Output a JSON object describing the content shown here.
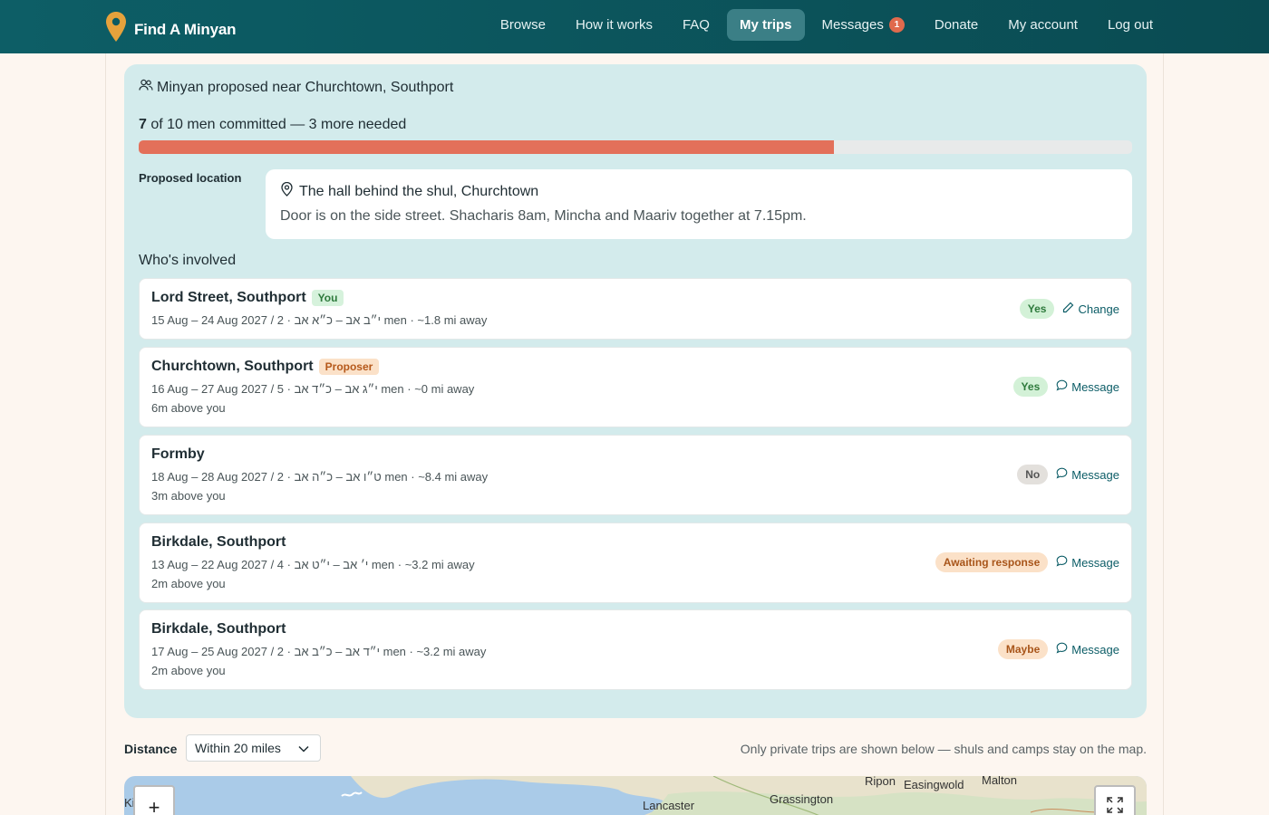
{
  "brand": {
    "name": "Find A Minyan",
    "icon": "map-pin-icon",
    "pin_color": "#e6a23c"
  },
  "nav": {
    "items": [
      {
        "label": "Browse"
      },
      {
        "label": "How it works"
      },
      {
        "label": "FAQ"
      },
      {
        "label": "My trips",
        "active": true
      },
      {
        "label": "Messages",
        "badge": "1"
      },
      {
        "label": "Donate"
      },
      {
        "label": "My account"
      },
      {
        "label": "Log out"
      }
    ]
  },
  "minyan": {
    "title": "Minyan proposed near Churchtown, Southport",
    "title_icon": "people-icon",
    "committed_count": "7",
    "committed_text": " of 10 men committed — 3 more needed",
    "progress_fraction": 0.7,
    "location_label": "Proposed location",
    "location_name": "The hall behind the shul, Churchtown",
    "location_icon": "location-pin-icon",
    "location_desc": "Door is on the side street. Shacharis 8am, Mincha and Maariv together at 7.15pm.",
    "involved_title": "Who's involved"
  },
  "trips": [
    {
      "name": "Lord Street, Southport",
      "tag": "You",
      "tag_type": "you",
      "meta": "15 Aug – 24 Aug 2027 / י״ב אב – כ״א אב · 2 men · ~1.8 mi away",
      "sub": "",
      "status": "Yes",
      "status_type": "yes",
      "action": "Change",
      "action_icon": "pencil-icon"
    },
    {
      "name": "Churchtown, Southport",
      "tag": "Proposer",
      "tag_type": "proposer",
      "meta": "16 Aug – 27 Aug 2027 / י״ג אב – כ״ד אב · 5 men · ~0 mi away",
      "sub": "6m above you",
      "status": "Yes",
      "status_type": "yes",
      "action": "Message",
      "action_icon": "chat-icon"
    },
    {
      "name": "Formby",
      "tag": "",
      "tag_type": "",
      "meta": "18 Aug – 28 Aug 2027 / ט״ו אב – כ״ה אב · 2 men · ~8.4 mi away",
      "sub": "3m above you",
      "status": "No",
      "status_type": "no",
      "action": "Message",
      "action_icon": "chat-icon"
    },
    {
      "name": "Birkdale, Southport",
      "tag": "",
      "tag_type": "",
      "meta": "13 Aug – 22 Aug 2027 / י׳ אב – י״ט אב · 4 men · ~3.2 mi away",
      "sub": "2m above you",
      "status": "Awaiting response",
      "status_type": "await",
      "action": "Message",
      "action_icon": "chat-icon"
    },
    {
      "name": "Birkdale, Southport",
      "tag": "",
      "tag_type": "",
      "meta": "17 Aug – 25 Aug 2027 / י״ד אב – כ״ב אב · 2 men · ~3.2 mi away",
      "sub": "2m above you",
      "status": "Maybe",
      "status_type": "maybe",
      "action": "Message",
      "action_icon": "chat-icon"
    }
  ],
  "distance": {
    "label": "Distance",
    "selected": "Within 20 miles",
    "note": "Only private trips are shown below — shuls and camps stay on the map."
  },
  "map": {
    "zoom_in_label": "+",
    "fullscreen_icon": "expand-icon",
    "places": [
      "Ki",
      "Lancaster",
      "Grassington",
      "Ripon",
      "Easingwold",
      "Malton"
    ]
  }
}
